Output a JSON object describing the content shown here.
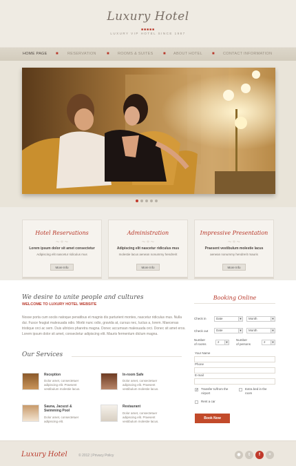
{
  "header": {
    "logo": "Luxury Hotel",
    "logo_dots": "■■■■■",
    "tagline": "LUXURY VIP HOTEL SINCE 1987"
  },
  "nav": {
    "items": [
      {
        "label": "HOME PAGE",
        "active": true
      },
      {
        "label": "RESERVATION"
      },
      {
        "label": "ROOMS & SUITES"
      },
      {
        "label": "ABOUT HOTEL"
      },
      {
        "label": "CONTACT INFORMATION"
      }
    ],
    "separator": "■"
  },
  "hero": {
    "slides": 5,
    "active_slide": 1
  },
  "features": [
    {
      "title": "Hotel Reservations",
      "subtitle": "Lorem ipsum dolor sit amet consectetur",
      "text": "Adipiscing elit nascetur ridiculus mus",
      "button": "More Info"
    },
    {
      "title": "Administration",
      "subtitle": "Adipiscing elit nascetur ridiculus mus",
      "text": "molestie lacus aenean nonummy hendrerit",
      "button": "More Info"
    },
    {
      "title": "Impressive Presentation",
      "subtitle": "Praesent vestibulum molestie lacus",
      "text": "aenean nonummy hendrerit mauris",
      "button": "More Info"
    }
  ],
  "welcome": {
    "heading": "We desire to unite people and cultures",
    "subheading": "WELCOME TO LUXURY HOTEL WEBSITE",
    "paragraph": [
      "Nosse porta cum sociis natoque penatibus et magnis dis parturient montes, nascetur ridiculus mus. Nulla",
      "dui. Fusce feugiat malesuada odio. Morbi nunc odio, gravida at, cursus nec, luctus a, lorem. Maecenas",
      "tristique orci ac sem. Duis ultricies pharetra magna. Donec accumsan malesuada orci. Donec sit amet eros.",
      "Lorem ipsum dolor sit amet, consectetur adipiscing elit. Mauris fermentum dictum magna."
    ]
  },
  "services": {
    "heading": "Our Services",
    "items": [
      {
        "title": "Reception",
        "text": [
          "Dolor amet, consectetuer",
          "adipiscing elit. Praesent",
          "vestibulum molestie lacus."
        ]
      },
      {
        "title": "In-room Safe",
        "text": [
          "Dolor amet, consectetuer",
          "adipiscing elit. Praesent",
          "vestibulum molestie lacus."
        ]
      },
      {
        "title": "Sauna, Jacuzzi &",
        "title2": "Swimming Pool",
        "text": [
          "Dolor amet, consectetuer",
          "adipiscing elit."
        ]
      },
      {
        "title": "Restaurant",
        "text": [
          "Dolor amet, consectetuer",
          "adipiscing elit. Praesent",
          "vestibulum molestie lacus."
        ]
      }
    ]
  },
  "booking": {
    "title": "Booking Online",
    "check_in": "Check in",
    "check_out": "Check out",
    "date_value": "Date",
    "month_value": "Month",
    "rooms_label": [
      "Number",
      "of rooms"
    ],
    "rooms_value": "2",
    "persons_label": [
      "Number",
      "of persons"
    ],
    "persons_value": "2",
    "name_label": "Your Name",
    "phone_label": "Phone",
    "email_label": "E-mail",
    "transfer_label": [
      "Transfer to/from the",
      "Airport"
    ],
    "extra_bed_label": [
      "Extra bed in the",
      "room"
    ],
    "rent_car_label": "Rent a car",
    "submit": "Book Now"
  },
  "footer": {
    "logo": "Luxury Hotel",
    "copyright": "© 2012",
    "divider": "|",
    "privacy": "Privacy Policy",
    "social": [
      "rss-icon",
      "twitter-icon",
      "facebook-icon",
      "google-plus-icon"
    ]
  },
  "colors": {
    "accent": "#b8382a",
    "button": "#c24a2a",
    "background": "#f1ede4"
  }
}
